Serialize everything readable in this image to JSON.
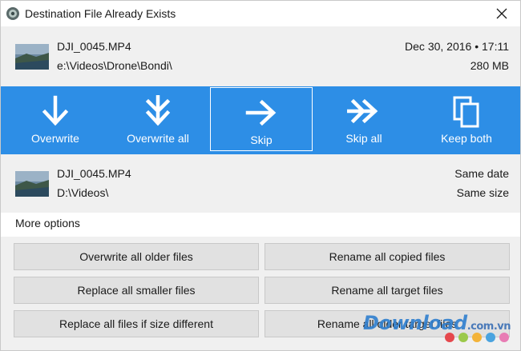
{
  "window": {
    "title": "Destination File Already Exists"
  },
  "source": {
    "name": "DJI_0045.MP4",
    "path": "e:\\Videos\\Drone\\Bondi\\",
    "date": "Dec 30, 2016 • 17:11",
    "size": "280 MB"
  },
  "actions": [
    {
      "label": "Overwrite",
      "icon": "arrow-down-icon"
    },
    {
      "label": "Overwrite all",
      "icon": "arrow-down-double-icon"
    },
    {
      "label": "Skip",
      "icon": "arrow-right-icon",
      "selected": true
    },
    {
      "label": "Skip all",
      "icon": "arrow-right-double-icon"
    },
    {
      "label": "Keep both",
      "icon": "copy-icon"
    }
  ],
  "destination": {
    "name": "DJI_0045.MP4",
    "path": "D:\\Videos\\",
    "date": "Same date",
    "size": "Same size"
  },
  "more_options": {
    "label": "More options"
  },
  "options": [
    "Overwrite all older files",
    "Rename all copied files",
    "Replace all smaller files",
    "Rename all target files",
    "Replace all files if size different",
    "Rename all older target files"
  ],
  "watermark": {
    "text": "Download",
    "domain": ".com.vn"
  },
  "colors": {
    "accent": "#2d8ee6",
    "window_bg": "#f0f0f0",
    "button_bg": "#e1e1e1"
  }
}
